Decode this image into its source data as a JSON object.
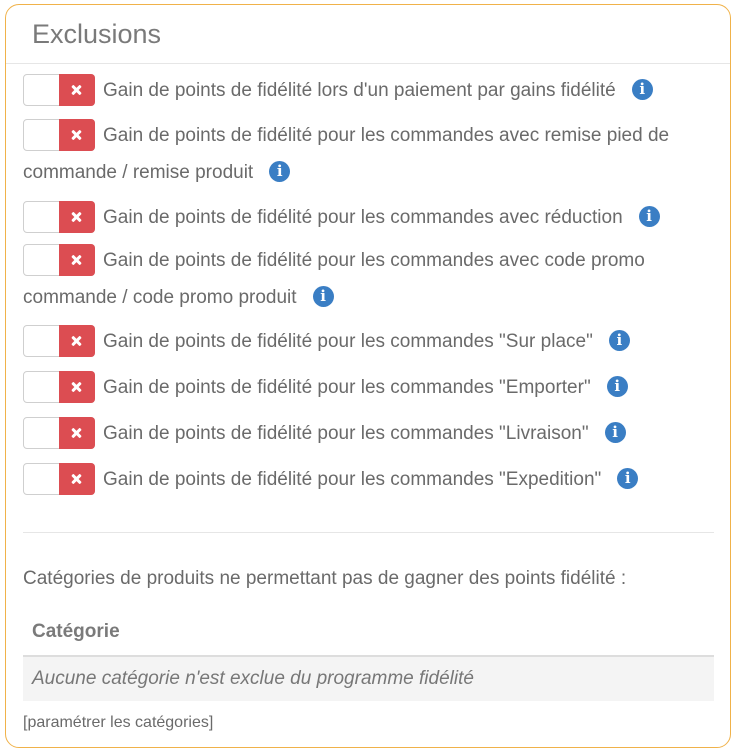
{
  "panel": {
    "title": "Exclusions"
  },
  "exclusions": [
    {
      "label": "Gain de points de fidélité lors d'un paiement par gains fidélité",
      "enabled": false
    },
    {
      "label": "Gain de points de fidélité pour les commandes avec remise pied de commande / remise produit",
      "enabled": false
    },
    {
      "label": "Gain de points de fidélité pour les commandes avec réduction",
      "enabled": false
    },
    {
      "label": "Gain de points de fidélité pour les commandes avec code promo commande / code promo produit",
      "enabled": false
    },
    {
      "label": "Gain de points de fidélité pour les commandes \"Sur place\"",
      "enabled": false
    },
    {
      "label": "Gain de points de fidélité pour les commandes \"Emporter\"",
      "enabled": false
    },
    {
      "label": "Gain de points de fidélité pour les commandes \"Livraison\"",
      "enabled": false
    },
    {
      "label": "Gain de points de fidélité pour les commandes \"Expedition\"",
      "enabled": false
    }
  ],
  "info_glyph": "i",
  "categories": {
    "caption": "Catégories de produits ne permettant pas de gagner des points fidélité :",
    "column_header": "Catégorie",
    "empty_message": "Aucune catégorie n'est exclue du programme fidélité",
    "configure_link": "[paramétrer les catégories]"
  },
  "colors": {
    "border": "#f0b24a",
    "toggle_off": "#dc4d52",
    "info": "#3a7ec4"
  },
  "icons": {
    "toggle_off": "close-x-icon",
    "info": "info-circle-icon"
  }
}
